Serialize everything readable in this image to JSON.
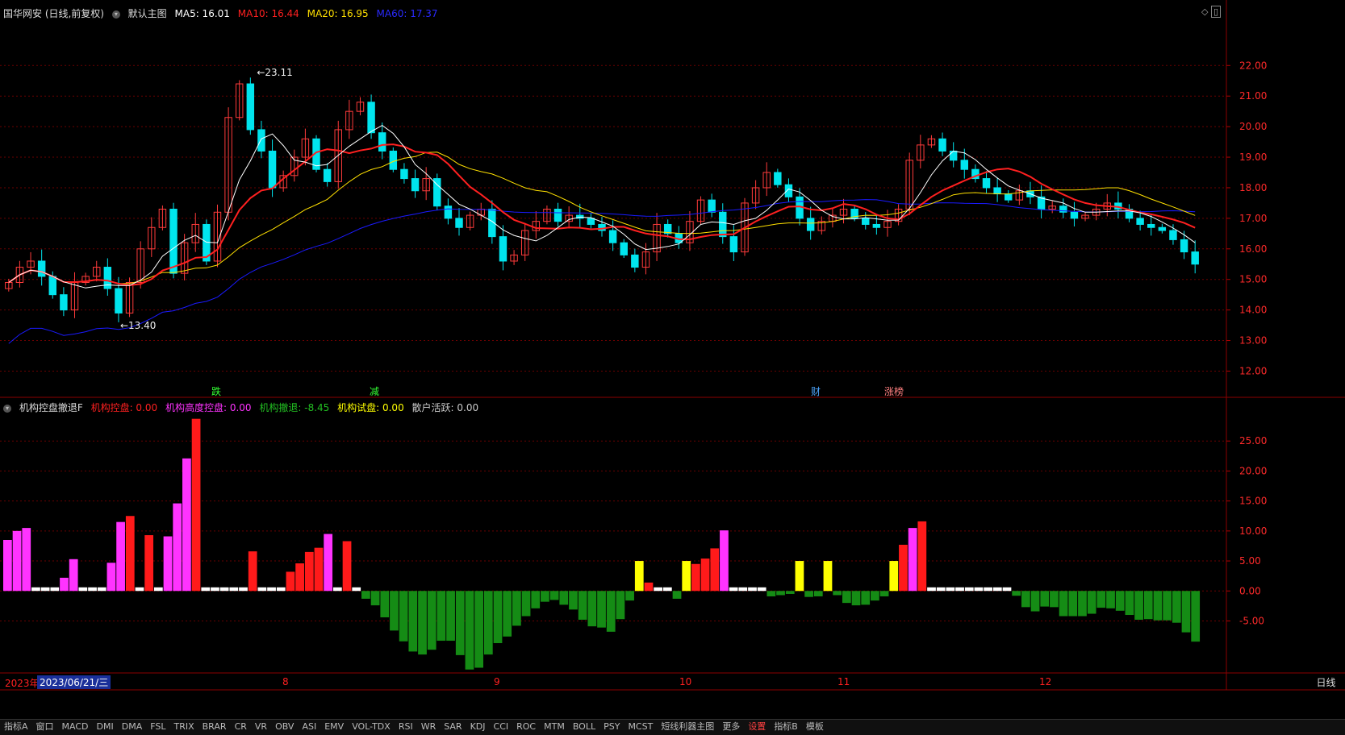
{
  "header": {
    "stock_title": "国华网安 (日线,前复权)",
    "main_chart": "默认主图",
    "ma5_label": "MA5: 16.01",
    "ma10_label": "MA10: 16.44",
    "ma20_label": "MA20: 16.95",
    "ma60_label": "MA60: 17.37",
    "ma5_color": "#ffffff",
    "ma10_color": "#ff2020",
    "ma20_color": "#ffe000",
    "ma60_color": "#1a1aff"
  },
  "indicator_header": {
    "name": "机构控盘撤退F",
    "control": "机构控盘: 0.00",
    "high_control": "机构高度控盘: 0.00",
    "retreat": "机构撤退: -8.45",
    "test": "机构试盘: 0.00",
    "retail": "散户活跃: 0.00"
  },
  "date_axis": {
    "year": "2023年",
    "cursor_date": "2023/06/21/三",
    "months": [
      "8",
      "9",
      "10",
      "11",
      "12"
    ],
    "period": "日线"
  },
  "bottom_tabs": [
    "指标A",
    "窗口",
    "MACD",
    "DMI",
    "DMA",
    "FSL",
    "TRIX",
    "BRAR",
    "CR",
    "VR",
    "OBV",
    "ASI",
    "EMV",
    "VOL-TDX",
    "RSI",
    "WR",
    "SAR",
    "KDJ",
    "CCI",
    "ROC",
    "MTM",
    "BOLL",
    "PSY",
    "MCST",
    "短线利器主图",
    "更多",
    "设置",
    "指标B",
    "模板"
  ],
  "event_markers": [
    "跌",
    "减",
    "财",
    "涨榜"
  ],
  "chart_data": [
    {
      "type": "candlestick",
      "title": "国华网安 (日线,前复权)",
      "y_ticks": [
        12.0,
        13.0,
        14.0,
        15.0,
        16.0,
        17.0,
        18.0,
        19.0,
        20.0,
        21.0,
        22.0
      ],
      "ylim": [
        11.3,
        23.3
      ],
      "high_marker": "23.11",
      "low_marker": "13.40",
      "last_close": 15.5,
      "ma": {
        "MA5": 16.01,
        "MA10": 16.44,
        "MA20": 16.95,
        "MA60": 17.37
      },
      "approx_close_path": [
        14.9,
        15.4,
        15.6,
        15.1,
        14.5,
        14.0,
        14.9,
        15.1,
        15.4,
        14.7,
        13.9,
        14.9,
        16.0,
        16.7,
        17.3,
        15.2,
        16.2,
        16.8,
        15.6,
        17.2,
        20.3,
        21.4,
        19.9,
        19.2,
        18.0,
        18.4,
        19.0,
        19.6,
        18.6,
        18.2,
        19.9,
        20.5,
        20.8,
        19.8,
        19.2,
        18.6,
        18.3,
        17.9,
        18.3,
        17.4,
        17.0,
        16.7,
        17.1,
        17.3,
        16.4,
        15.6,
        15.8,
        16.6,
        16.9,
        17.3,
        16.9,
        17.1,
        17.0,
        16.8,
        16.6,
        16.2,
        15.8,
        15.4,
        15.9,
        16.8,
        16.5,
        16.2,
        16.9,
        17.6,
        17.2,
        16.4,
        15.9,
        17.5,
        18.0,
        18.5,
        18.1,
        17.7,
        17.0,
        16.6,
        16.9,
        17.1,
        17.3,
        17.0,
        16.8,
        16.7,
        16.9,
        17.3,
        18.9,
        19.4,
        19.6,
        19.2,
        18.9,
        18.6,
        18.3,
        18.0,
        17.8,
        17.6,
        17.9,
        17.7,
        17.3,
        17.4,
        17.2,
        17.0,
        17.1,
        17.3,
        17.5,
        17.3,
        17.0,
        16.8,
        16.7,
        16.6,
        16.3,
        15.9,
        15.5
      ]
    },
    {
      "type": "bar",
      "title": "机构控盘撤退F",
      "y_ticks": [
        -5.0,
        0.0,
        5.0,
        10.0,
        15.0,
        20.0,
        25.0
      ],
      "ylim": [
        -13,
        30
      ],
      "series": [
        {
          "name": "机构控盘",
          "color": "#ff1a1a"
        },
        {
          "name": "机构高度控盘",
          "color": "#ff33ff"
        },
        {
          "name": "机构撤退",
          "color": "#158c15"
        },
        {
          "name": "机构试盘",
          "color": "#ffff00"
        },
        {
          "name": "散户活跃",
          "color": "#ffffff"
        }
      ],
      "bars": [
        {
          "s": "机构高度控盘",
          "v": 8.5
        },
        {
          "s": "机构高度控盘",
          "v": 10
        },
        {
          "s": "机构高度控盘",
          "v": 10.5
        },
        {
          "s": "散户活跃",
          "v": 0.6
        },
        {
          "s": "散户活跃",
          "v": 0.6
        },
        {
          "s": "散户活跃",
          "v": 0.6
        },
        {
          "s": "机构高度控盘",
          "v": 2.2
        },
        {
          "s": "机构高度控盘",
          "v": 5.3
        },
        {
          "s": "散户活跃",
          "v": 0.6
        },
        {
          "s": "散户活跃",
          "v": 0.6
        },
        {
          "s": "散户活跃",
          "v": 0.6
        },
        {
          "s": "机构高度控盘",
          "v": 4.7
        },
        {
          "s": "机构高度控盘",
          "v": 11.5
        },
        {
          "s": "机构控盘",
          "v": 12.5
        },
        {
          "s": "散户活跃",
          "v": 0.6
        },
        {
          "s": "机构控盘",
          "v": 9.3
        },
        {
          "s": "散户活跃",
          "v": 0.6
        },
        {
          "s": "机构高度控盘",
          "v": 9.1
        },
        {
          "s": "机构高度控盘",
          "v": 14.6
        },
        {
          "s": "机构高度控盘",
          "v": 22.1
        },
        {
          "s": "机构控盘",
          "v": 28.7
        },
        {
          "s": "散户活跃",
          "v": 0.6
        },
        {
          "s": "散户活跃",
          "v": 0.6
        },
        {
          "s": "散户活跃",
          "v": 0.6
        },
        {
          "s": "散户活跃",
          "v": 0.6
        },
        {
          "s": "散户活跃",
          "v": 0.6
        },
        {
          "s": "机构控盘",
          "v": 6.6
        },
        {
          "s": "散户活跃",
          "v": 0.6
        },
        {
          "s": "散户活跃",
          "v": 0.6
        },
        {
          "s": "散户活跃",
          "v": 0.6
        },
        {
          "s": "机构控盘",
          "v": 3.2
        },
        {
          "s": "机构控盘",
          "v": 4.6
        },
        {
          "s": "机构控盘",
          "v": 6.5
        },
        {
          "s": "机构控盘",
          "v": 7.2
        },
        {
          "s": "机构高度控盘",
          "v": 9.5
        },
        {
          "s": "散户活跃",
          "v": 0.6
        },
        {
          "s": "机构控盘",
          "v": 8.3
        },
        {
          "s": "散户活跃",
          "v": 0.6
        },
        {
          "s": "机构撤退",
          "v": -1.3
        },
        {
          "s": "机构撤退",
          "v": -2.4
        },
        {
          "s": "机构撤退",
          "v": -4.4
        },
        {
          "s": "机构撤退",
          "v": -6.6
        },
        {
          "s": "机构撤退",
          "v": -8.4
        },
        {
          "s": "机构撤退",
          "v": -10.1
        },
        {
          "s": "机构撤退",
          "v": -10.6
        },
        {
          "s": "机构撤退",
          "v": -9.8
        },
        {
          "s": "机构撤退",
          "v": -8.3
        },
        {
          "s": "机构撤退",
          "v": -8.3
        },
        {
          "s": "机构撤退",
          "v": -10.7
        },
        {
          "s": "机构撤退",
          "v": -13.1
        },
        {
          "s": "机构撤退",
          "v": -12.8
        },
        {
          "s": "机构撤退",
          "v": -10.6
        },
        {
          "s": "机构撤退",
          "v": -8.7
        },
        {
          "s": "机构撤退",
          "v": -7.6
        },
        {
          "s": "机构撤退",
          "v": -5.8
        },
        {
          "s": "机构撤退",
          "v": -4.2
        },
        {
          "s": "机构撤退",
          "v": -2.9
        },
        {
          "s": "机构撤退",
          "v": -1.8
        },
        {
          "s": "机构撤退",
          "v": -1.5
        },
        {
          "s": "机构撤退",
          "v": -2.3
        },
        {
          "s": "机构撤退",
          "v": -3.1
        },
        {
          "s": "机构撤退",
          "v": -4.8
        },
        {
          "s": "机构撤退",
          "v": -5.9
        },
        {
          "s": "机构撤退",
          "v": -6.1
        },
        {
          "s": "机构撤退",
          "v": -6.8
        },
        {
          "s": "机构撤退",
          "v": -4.7
        },
        {
          "s": "机构撤退",
          "v": -1.6
        },
        {
          "s": "机构试盘",
          "v": 5.0
        },
        {
          "s": "机构控盘",
          "v": 1.4
        },
        {
          "s": "散户活跃",
          "v": 0.6
        },
        {
          "s": "散户活跃",
          "v": 0.6
        },
        {
          "s": "机构撤退",
          "v": -1.3
        },
        {
          "s": "机构试盘",
          "v": 5.0
        },
        {
          "s": "机构控盘",
          "v": 4.5
        },
        {
          "s": "机构控盘",
          "v": 5.4
        },
        {
          "s": "机构控盘",
          "v": 7.1
        },
        {
          "s": "机构高度控盘",
          "v": 10.1
        },
        {
          "s": "散户活跃",
          "v": 0.6
        },
        {
          "s": "散户活跃",
          "v": 0.6
        },
        {
          "s": "散户活跃",
          "v": 0.6
        },
        {
          "s": "散户活跃",
          "v": 0.6
        },
        {
          "s": "机构撤退",
          "v": -0.9
        },
        {
          "s": "机构撤退",
          "v": -0.7
        },
        {
          "s": "机构撤退",
          "v": -0.5
        },
        {
          "s": "机构试盘",
          "v": 5.0
        },
        {
          "s": "机构撤退",
          "v": -1.0
        },
        {
          "s": "机构撤退",
          "v": -0.9
        },
        {
          "s": "机构试盘",
          "v": 5.0
        },
        {
          "s": "机构撤退",
          "v": -0.7
        },
        {
          "s": "机构撤退",
          "v": -2.0
        },
        {
          "s": "机构撤退",
          "v": -2.4
        },
        {
          "s": "机构撤退",
          "v": -2.3
        },
        {
          "s": "机构撤退",
          "v": -1.6
        },
        {
          "s": "机构撤退",
          "v": -0.9
        },
        {
          "s": "机构试盘",
          "v": 5.0
        },
        {
          "s": "机构控盘",
          "v": 7.7
        },
        {
          "s": "机构高度控盘",
          "v": 10.5
        },
        {
          "s": "机构控盘",
          "v": 11.6
        },
        {
          "s": "散户活跃",
          "v": 0.6
        },
        {
          "s": "散户活跃",
          "v": 0.6
        },
        {
          "s": "散户活跃",
          "v": 0.6
        },
        {
          "s": "散户活跃",
          "v": 0.6
        },
        {
          "s": "散户活跃",
          "v": 0.6
        },
        {
          "s": "散户活跃",
          "v": 0.6
        },
        {
          "s": "散户活跃",
          "v": 0.6
        },
        {
          "s": "散户活跃",
          "v": 0.6
        },
        {
          "s": "散户活跃",
          "v": 0.6
        },
        {
          "s": "机构撤退",
          "v": -0.8
        },
        {
          "s": "机构撤退",
          "v": -2.7
        },
        {
          "s": "机构撤退",
          "v": -3.4
        },
        {
          "s": "机构撤退",
          "v": -2.6
        },
        {
          "s": "机构撤退",
          "v": -2.7
        },
        {
          "s": "机构撤退",
          "v": -4.2
        },
        {
          "s": "机构撤退",
          "v": -4.2
        },
        {
          "s": "机构撤退",
          "v": -4.2
        },
        {
          "s": "机构撤退",
          "v": -3.8
        },
        {
          "s": "机构撤退",
          "v": -2.8
        },
        {
          "s": "机构撤退",
          "v": -2.9
        },
        {
          "s": "机构撤退",
          "v": -3.3
        },
        {
          "s": "机构撤退",
          "v": -4.0
        },
        {
          "s": "机构撤退",
          "v": -4.8
        },
        {
          "s": "机构撤退",
          "v": -4.7
        },
        {
          "s": "机构撤退",
          "v": -4.9
        },
        {
          "s": "机构撤退",
          "v": -4.9
        },
        {
          "s": "机构撤退",
          "v": -5.3
        },
        {
          "s": "机构撤退",
          "v": -6.9
        },
        {
          "s": "机构撤退",
          "v": -8.45
        }
      ]
    }
  ]
}
